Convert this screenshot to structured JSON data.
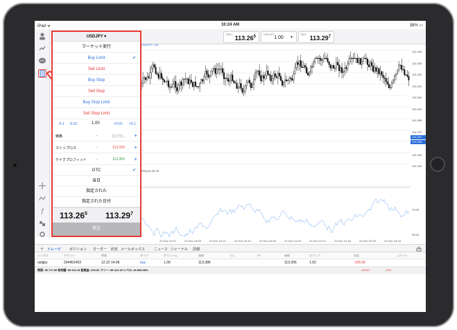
{
  "status": {
    "carrier": "iPad ᯤ",
    "time": "10:24 AM",
    "battery": "38% ▭"
  },
  "quote": {
    "sell_label": "SELL",
    "sell_main": "113.26",
    "sell_pip": "5",
    "symbol_label": "USDJPY",
    "lot": "1.00",
    "buy_label": "BUY",
    "buy_main": "113.29",
    "buy_pip": "7"
  },
  "order_panel": {
    "title": "USDJPY ▾",
    "types": [
      {
        "label": "マーケット実行",
        "kind": "plain",
        "checked": false
      },
      {
        "label": "Buy Limit",
        "kind": "buy",
        "checked": true
      },
      {
        "label": "Sell Limit",
        "kind": "sell",
        "checked": false
      },
      {
        "label": "Buy Stop",
        "kind": "buy",
        "checked": false
      },
      {
        "label": "Sell Stop",
        "kind": "sell",
        "checked": false
      },
      {
        "label": "Buy Stop Limit",
        "kind": "buy",
        "checked": false
      },
      {
        "label": "Sell Stop Limit",
        "kind": "sell",
        "checked": false
      }
    ],
    "steps": {
      "m1": "-0.1",
      "m2": "-0.01",
      "lot": "1.00",
      "p2": "+0.01",
      "p1": "+0.1"
    },
    "fields": [
      {
        "label": "価格",
        "value": "設定無し",
        "value_color": "#bbbbbb"
      },
      {
        "label": "ストップロス",
        "value": "113.150",
        "value_color": "#e53935"
      },
      {
        "label": "テイクプロフィット",
        "value": "113.350",
        "value_color": "#2e9e44"
      }
    ],
    "expiry": [
      {
        "label": "GTC",
        "checked": true
      },
      {
        "label": "当日",
        "checked": false
      },
      {
        "label": "指定された",
        "checked": false
      },
      {
        "label": "指定された日付",
        "checked": false
      }
    ],
    "sell_main": "113.26",
    "sell_pip": "5",
    "buy_main": "113.29",
    "buy_pip": "7",
    "order_button": "発注"
  },
  "chart": {
    "symbol": "USDJPY • M1",
    "rsi_label": "RSI(14) 35.29",
    "y_ticks": [
      "113.340",
      "113.330",
      "113.320",
      "113.310",
      "113.300",
      "113.290",
      "113.280",
      "113.270",
      "113.260",
      "113.250",
      "113.240"
    ],
    "tag_a": "113.297",
    "tag_b": "113.265",
    "rsi_ticks": [
      "70.00",
      "30.00"
    ],
    "x_ticks": [
      "22 Dec 19:37",
      "22 Dec 19:55",
      "22 Dec 19:41",
      "22 Dec 20:10",
      "22 Dec 20:46",
      "22 Dec 21:49",
      "22 Dec 21:21",
      "22 Dec 21:48",
      "22 Dec 22:53",
      "22 Dec 23:23"
    ]
  },
  "tabs": [
    "トレード",
    "ポジション",
    "オーダー",
    "約定",
    "メールボックス",
    "ニュース",
    "ジャーナル",
    "詳細"
  ],
  "trade_table": {
    "headers": [
      "シンボル",
      "チケット",
      "時間",
      "タイプ",
      "ボリューム",
      "価格",
      "S/L",
      "T/P",
      "価格",
      "スワップ",
      "利益",
      "コメント"
    ],
    "row": [
      "usdjpy",
      "204452453",
      "12.22 14:06",
      "buy",
      "1.00",
      "113.386",
      "",
      "",
      "113.265",
      "1.02",
      "-105.65",
      ""
    ]
  },
  "balance": {
    "text": "残高: 99 717.96 有効額: 99 612.15 証拠金: 200.00 フリー: 99 412.15 レベル: 49 806.08%",
    "value": "-105.81",
    "currency": "USD"
  },
  "icons": {
    "left_toolbar": [
      "account-icon",
      "quotes-icon",
      "chat-icon",
      "new-order-icon",
      "crosshair-icon",
      "indicators-icon",
      "function-icon",
      "objects-icon",
      "settings-icon"
    ]
  }
}
